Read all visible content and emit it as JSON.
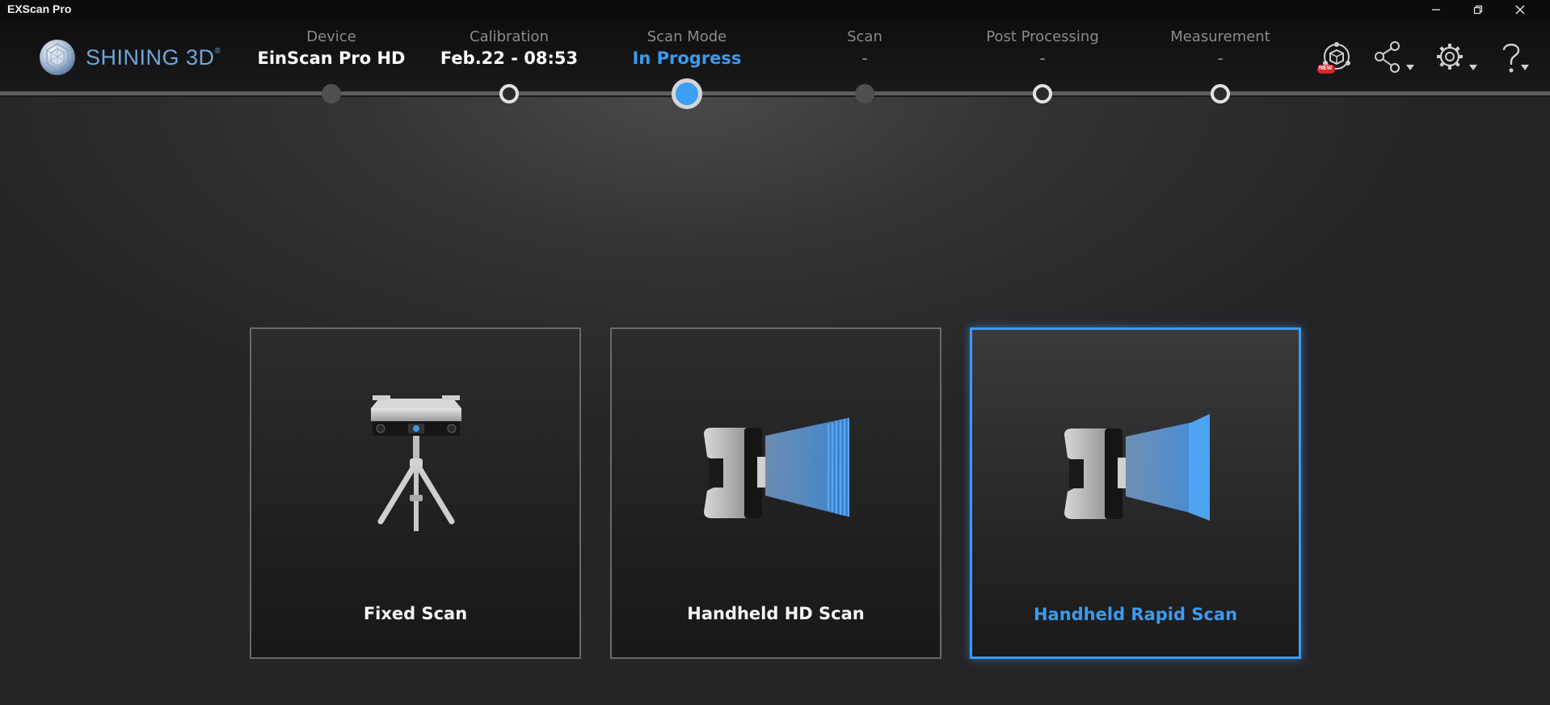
{
  "window": {
    "title": "EXScan Pro",
    "minimize_icon": "minimize-icon",
    "restore_icon": "restore-icon",
    "close_icon": "close-icon"
  },
  "brand": {
    "name": "SHINING 3D",
    "trademark": "®"
  },
  "steps": [
    {
      "label": "Device",
      "value": "EinScan Pro HD",
      "state": "done"
    },
    {
      "label": "Calibration",
      "value": "Feb.22 - 08:53",
      "state": "done"
    },
    {
      "label": "Scan Mode",
      "value": "In Progress",
      "state": "current"
    },
    {
      "label": "Scan",
      "value": "-",
      "state": "pending"
    },
    {
      "label": "Post Processing",
      "value": "-",
      "state": "pending"
    },
    {
      "label": "Measurement",
      "value": "-",
      "state": "pending"
    }
  ],
  "toolbar": {
    "new_badge": "NEW",
    "icons": [
      "model-new-icon",
      "share-icon",
      "settings-icon",
      "help-icon"
    ]
  },
  "scan_modes": [
    {
      "label": "Fixed Scan",
      "icon": "tripod-scanner-icon",
      "selected": false
    },
    {
      "label": "Handheld HD Scan",
      "icon": "handheld-hd-scanner-icon",
      "selected": false
    },
    {
      "label": "Handheld Rapid Scan",
      "icon": "handheld-rapid-scanner-icon",
      "selected": true
    }
  ],
  "colors": {
    "accent": "#3a9bf0",
    "brand": "#6ea7da",
    "inactive_text": "#8b8b8b"
  }
}
